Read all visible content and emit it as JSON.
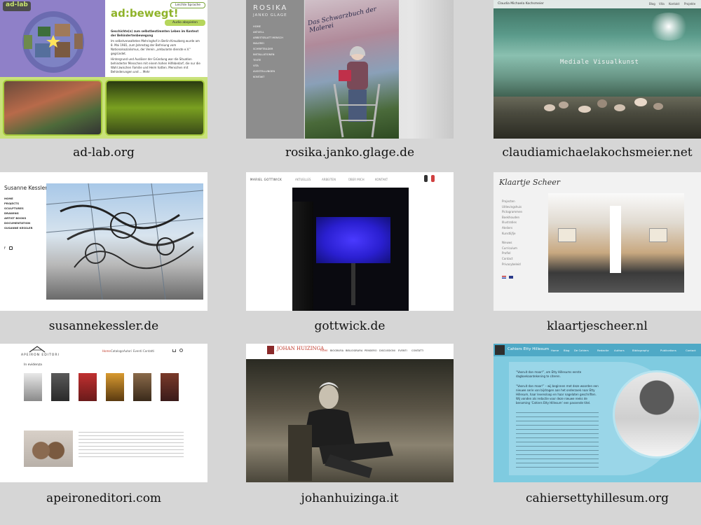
{
  "sites": [
    {
      "caption": "ad-lab.org",
      "logo": "ad-lab",
      "headline": "ad:bewegt!",
      "pill": "Leichte Sprache",
      "audio": "Audio abspielen",
      "para1": "Geschichte(n) zum selbstbestimmten Leben im Kontext der Behindertenbewegung",
      "para2": "Im selbstverwalteten Mehringhof in Berlin-Kreuzberg wurde am 8. Mai 1981, zum Jahrestag der Befreiung vom Nationalsozialismus, der Verein „ambulante dienste e.V.“ gegründet.",
      "para3": "Hintergrund und Auslöser der Gründung war die Situation behinderter Menschen mit einem hohen Hilfebedarf, die nur die Wahl zwischen Familie und Heim hatten. Menschen mit Behinderungen und ... Mehr"
    },
    {
      "caption": "rosika.janko.glage.de",
      "title": "ROSIKA",
      "subtitle": "JANKO GLAGE",
      "menu": [
        "HOME",
        "AKTUELL",
        "ARBEITSBLATT MENSCH",
        "MALEREI",
        "SCHRIFTBILDER",
        "INSTALLATIONEN",
        "TEXTE",
        "VITA",
        "AUSSTELLUNGEN",
        "KONTAKT"
      ],
      "painting_text": "Das Schwarzbuch der Malerei"
    },
    {
      "caption": "claudiamichaelakochsmeier.net",
      "brand": "Claudia Michaela Kochsmeier",
      "nav": [
        "Blog",
        "Vita",
        "Kontakt",
        "Projekte"
      ],
      "hero": "Mediale Visualkunst"
    },
    {
      "caption": "susannekessler.de",
      "name": "Susanne Kessler",
      "menu": [
        "HOME",
        "PROJECTS",
        "SCULPTURES",
        "DRAWING",
        "ARTIST BOOKS",
        "DOCUMENTATION",
        "SUSANNE KESSLER"
      ]
    },
    {
      "caption": "gottwick.de",
      "brand": "MARIEL GOTTWICK",
      "nav": [
        "AKTUELLES",
        "ARBEITEN",
        "ÜBER MICH",
        "KONTAKT"
      ]
    },
    {
      "caption": "klaartjescheer.nl",
      "logo": "Klaartje Scheer",
      "menu": [
        "Projecten",
        "Uitlevingshuis",
        "Pictogrammen",
        "Boekhouden",
        "Illustraties",
        "Ateliers",
        "Kunstlijfje",
        "Nieuws",
        "Curriculum",
        "Profiel",
        "Contact",
        "Privacybeleid"
      ]
    },
    {
      "caption": "apeironeditori.com",
      "logo": "APEIRON EDITORI",
      "nav": [
        "Home",
        "Catalogo",
        "Autori",
        "Eventi",
        "Contatti"
      ],
      "section": "In evidenza"
    },
    {
      "caption": "johanhuizinga.it",
      "title": "JOHAN HUIZINGA",
      "nav": [
        "HOME",
        "BIOGRAFIA",
        "BIBLIOGRAFIA",
        "PENSIERO",
        "DISCUSSIONI",
        "EVENTI",
        "CONTATTI"
      ]
    },
    {
      "caption": "cahiersettyhillesum.org",
      "brand": "Cahiers Etty Hillesum",
      "nav": [
        "Home",
        "Blog",
        "De Cahiers",
        "Redactie",
        "Authors",
        "Bibliography",
        "Publications",
        "Contact"
      ],
      "quote": "“Vooruit dan maar!”, om Etty Hillesums eerste dagboekaantekening te citeren.",
      "body": "“Vooruit dan maar!” – wij beginnen met deze woorden een nieuwe serie van bijdragen aan het onderzoek naar Etty Hillesum, haar levensloop en haar nagelaten geschriften. Wij vonden als redactie voor deze nieuwe reeks de benaming ‘Cahiers Etty Hillesum’ een passende titel."
    }
  ],
  "colors": {
    "background": "#d6d6d6",
    "adlab_green": "#a7cc3d",
    "adlab_purple": "#8b78c4",
    "gottwick_blue": "#2a1fd0",
    "etty_blue": "#7fcbe0",
    "huizinga_red": "#c0392b"
  }
}
